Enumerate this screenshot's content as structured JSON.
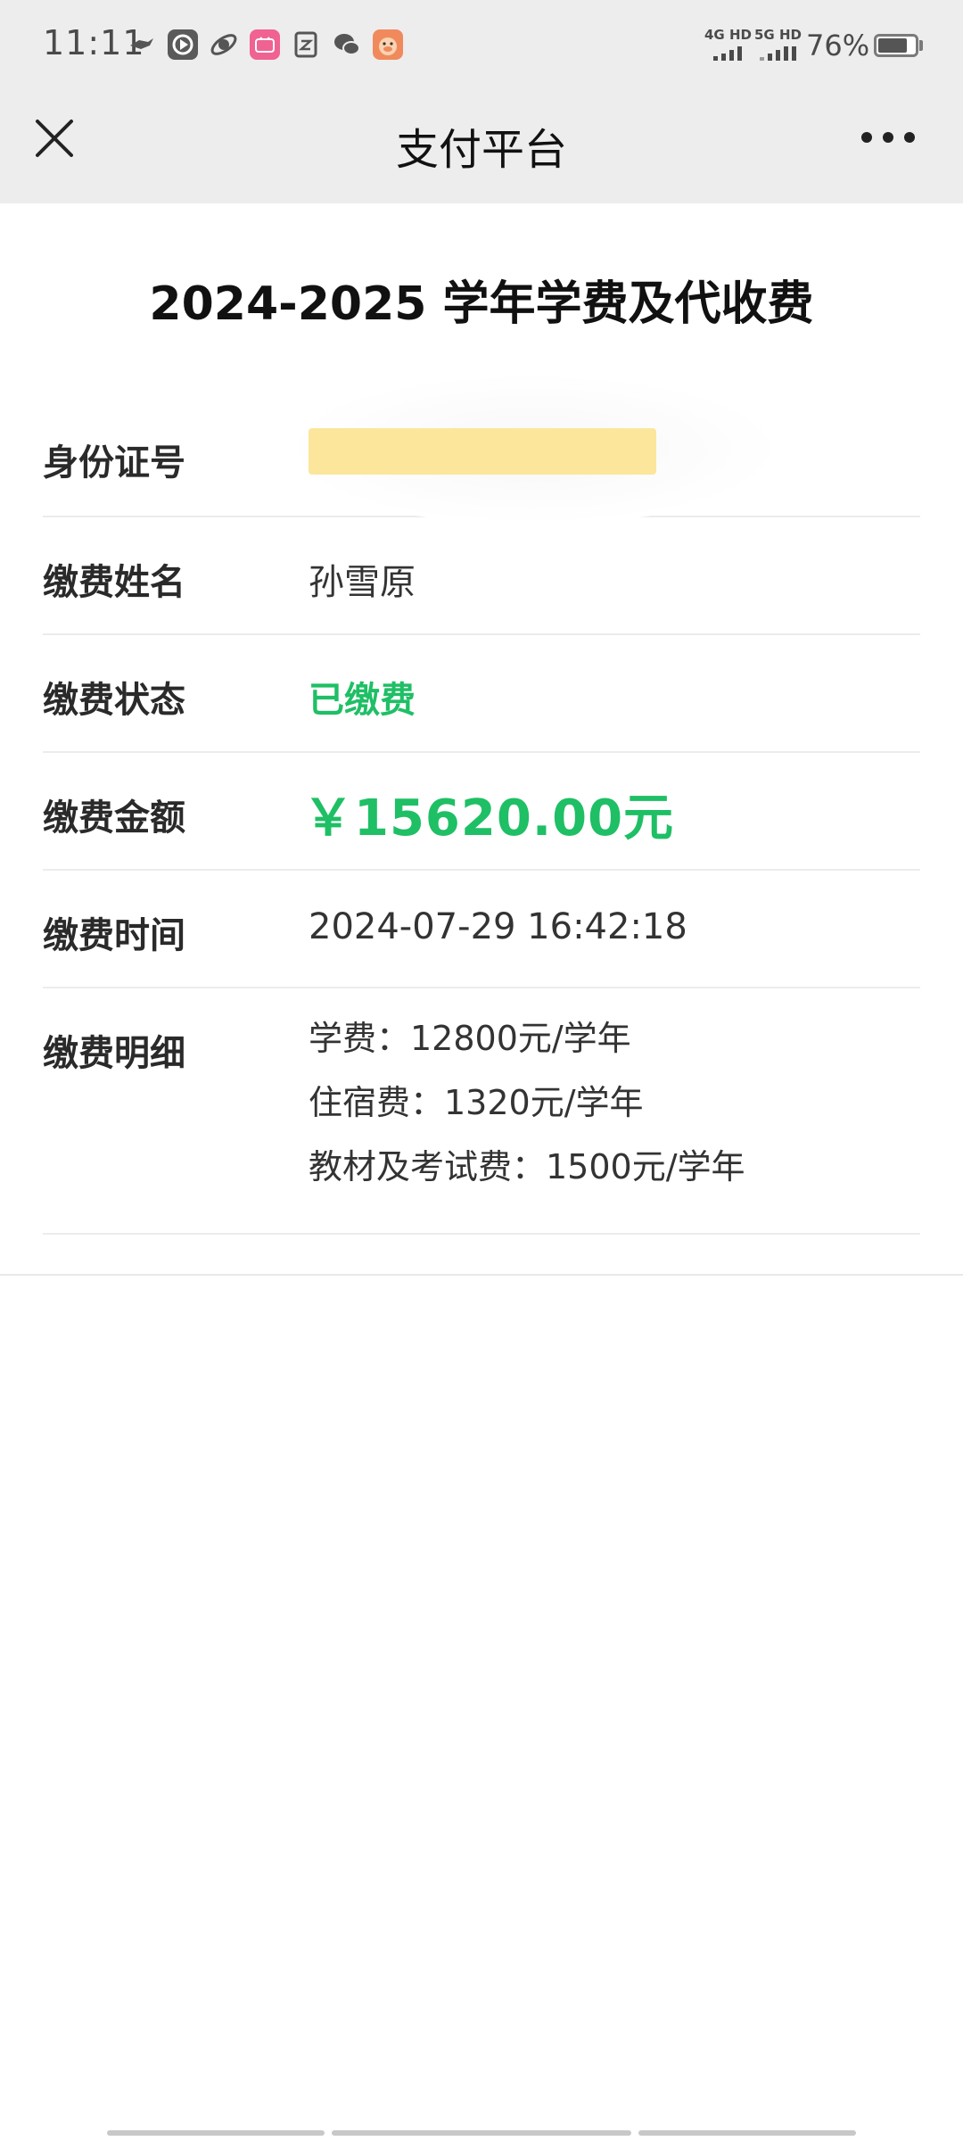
{
  "status_bar": {
    "time": "11:11",
    "network_1": "4G HD",
    "network_2": "5G HD",
    "battery": "76%",
    "app_icons": [
      "bird-icon",
      "play-icon",
      "planet-icon",
      "bilibili-icon",
      "note-icon",
      "wechat-icon",
      "pig-icon"
    ]
  },
  "nav": {
    "title": "支付平台",
    "close_icon": "close-icon",
    "more_icon": "more-icon"
  },
  "page": {
    "heading": "2024-2025 学年学费及代收费"
  },
  "rows": {
    "id_number": {
      "label": "身份证号",
      "value": ""
    },
    "payer_name": {
      "label": "缴费姓名",
      "value": "孙雪原"
    },
    "status": {
      "label": "缴费状态",
      "value": "已缴费"
    },
    "amount": {
      "label": "缴费金额",
      "value": "￥15620.00元"
    },
    "time": {
      "label": "缴费时间",
      "value": "2024-07-29 16:42:18"
    },
    "details": {
      "label": "缴费明细",
      "lines": [
        "学费：12800元/学年",
        "住宿费：1320元/学年",
        "教材及考试费：1500元/学年"
      ]
    }
  },
  "colors": {
    "accent_green": "#1fbf65",
    "header_bg": "#ededed",
    "mask_yellow": "#fbe69b"
  }
}
